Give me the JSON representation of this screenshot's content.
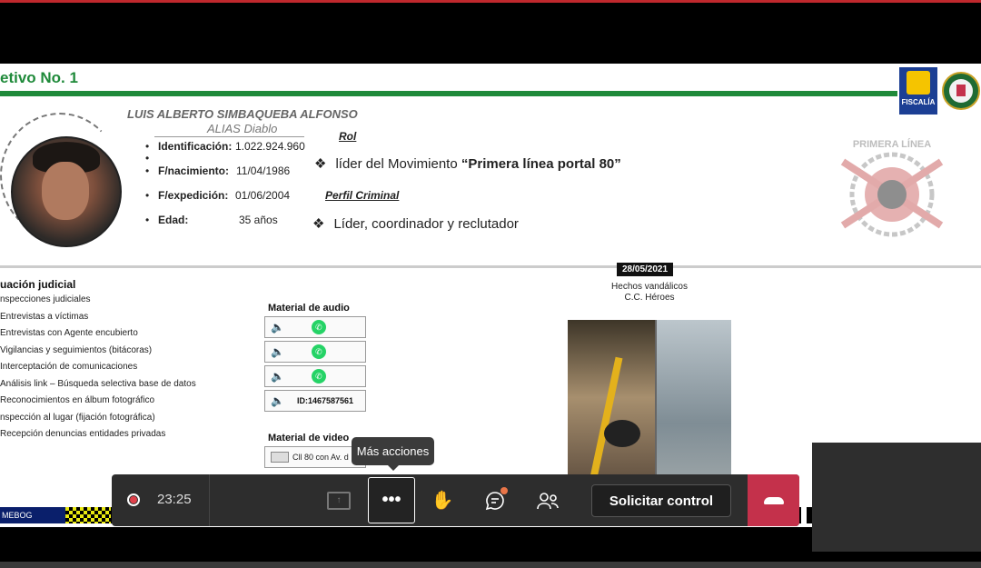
{
  "slide": {
    "title": "etivo No. 1",
    "logo_text": "FISCALÍA",
    "name": "LUIS ALBERTO SIMBAQUEBA ALFONSO",
    "alias": "ALIAS Diablo",
    "bio": [
      {
        "label": "Identificación:",
        "value": "1.022.924.960"
      },
      {
        "label": "F/nacimiento:",
        "value": "11/04/1986"
      },
      {
        "label": "F/expedición:",
        "value": "01/06/2004"
      },
      {
        "label": "Edad:",
        "value": "35 años"
      }
    ],
    "rol_heading": "Rol",
    "rol_prefix": "líder del Movimiento ",
    "rol_bold": "“Primera línea portal 80”",
    "perfil_heading": "Perfil Criminal",
    "perfil_text": "Líder, coordinador y reclutador",
    "emblem_text": "PRIMERA LÍNEA",
    "situacion_title": "uación judicial",
    "situacion_items": [
      "nspecciones judiciales",
      "Entrevistas a víctimas",
      "Entrevistas con Agente encubierto",
      "Vigilancias y seguimientos (bitácoras)",
      "Interceptación de comunicaciones",
      "Análisis link – Búsqueda selectiva base de datos",
      "Reconocimientos en álbum fotográfico",
      "nspección al lugar (fijación fotográfica)",
      "Recepción denuncias entidades privadas"
    ],
    "audio_title": "Material de audio",
    "audio_id": "ID:1467587561",
    "video_title": "Material de video",
    "video_item": "Cll 80 con Av. d",
    "date_badge": "28/05/2021",
    "caption_line1": "Hechos vandálicos",
    "caption_line2": "C.C. Héroes",
    "footer_label": "MEBOG"
  },
  "toolbar": {
    "tooltip": "Más acciones",
    "timer": "23:25",
    "request_control": "Solicitar control",
    "icons": {
      "record": "record-icon",
      "share": "share-screen-icon",
      "more": "more-actions-icon",
      "hand": "raise-hand-icon",
      "chat": "chat-icon",
      "people": "participants-icon",
      "hangup": "hang-up-icon"
    },
    "colors": {
      "hangup": "#c4314b",
      "record": "#e0414b",
      "chat_badge": "#e97548"
    }
  }
}
